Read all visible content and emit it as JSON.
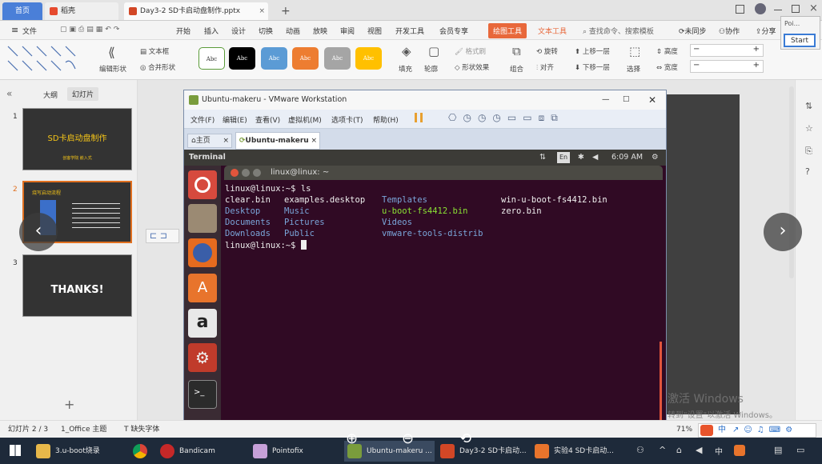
{
  "tabs": {
    "home": "首页",
    "shell": "稻壳",
    "doc": "Day3-2 SD卡启动盘制作.pptx",
    "add": "+"
  },
  "menu": {
    "file": "文件",
    "items": [
      "开始",
      "插入",
      "设计",
      "切换",
      "动画",
      "放映",
      "审阅",
      "视图",
      "开发工具",
      "会员专享"
    ],
    "drawing_tools": "绘图工具",
    "text_tools": "文本工具",
    "search": "查找命令、搜索模板",
    "unsynced": "未同步",
    "collab": "协作",
    "share": "分享",
    "tooltip": "Poi...",
    "start": "Start"
  },
  "ribbon": {
    "edit_shape": "编辑形状",
    "textbox": "文本框",
    "merge_shape": "合并形状",
    "swatch_label": "Abc",
    "fill": "填充",
    "outline": "轮廓",
    "format_brush": "格式刷",
    "shape_effect": "形状效果",
    "combine": "组合",
    "rotate": "旋转",
    "align": "对齐",
    "bring_forward": "上移一层",
    "send_backward": "下移一层",
    "select": "选择",
    "height": "高度",
    "width": "宽度"
  },
  "sidebar": {
    "outline_tab": "大纲",
    "slides_tab": "幻灯片",
    "slides": [
      {
        "num": "1",
        "title": "SD卡启动盘制作",
        "sub": "创客学院 嵌入式"
      },
      {
        "num": "2",
        "title": "烧写启动流程"
      },
      {
        "num": "3",
        "title": "THANKS!"
      }
    ],
    "add": "+"
  },
  "vmware": {
    "title": "Ubuntu-makeru - VMware Workstation",
    "menu": [
      "文件(F)",
      "编辑(E)",
      "查看(V)",
      "虚拟机(M)",
      "选项卡(T)",
      "帮助(H)"
    ],
    "tab_home": "主页",
    "tab_vm": "Ubuntu-makeru",
    "topbar_app": "Terminal",
    "topbar_lang": "En",
    "topbar_time": "6:09 AM"
  },
  "terminal": {
    "title": "linux@linux: ~",
    "prompt1": "linux@linux:~$ ls",
    "rows": [
      [
        "clear.bin",
        "examples.desktop",
        "Templates",
        "win-u-boot-fs4412.bin"
      ],
      [
        "Desktop",
        "Music",
        "u-boot-fs4412.bin",
        "zero.bin"
      ],
      [
        "Documents",
        "Pictures",
        "Videos",
        ""
      ],
      [
        "Downloads",
        "Public",
        "vmware-tools-distrib",
        ""
      ]
    ],
    "prompt2": "linux@linux:~$ ",
    "colors": {
      "dir": "#7aa6da",
      "exec": "#8ae234",
      "plain": "#eeeeee"
    }
  },
  "statusbar": {
    "slide_pos": "幻灯片 2 / 3",
    "theme": "1_Office 主题",
    "missing_font": "缺失字体",
    "zoom": "71%"
  },
  "watermark": {
    "line1": "激活 Windows",
    "line2": "转到\"设置\"以激活 Windows。"
  },
  "taskbar": {
    "items": [
      "3.u-boot烧录",
      "Bandicam",
      "Pointofix",
      "Ubuntu-makeru ...",
      "Day3-2 SD卡启动...",
      "实验4 SD卡启动..."
    ],
    "tray_lang": "中"
  }
}
